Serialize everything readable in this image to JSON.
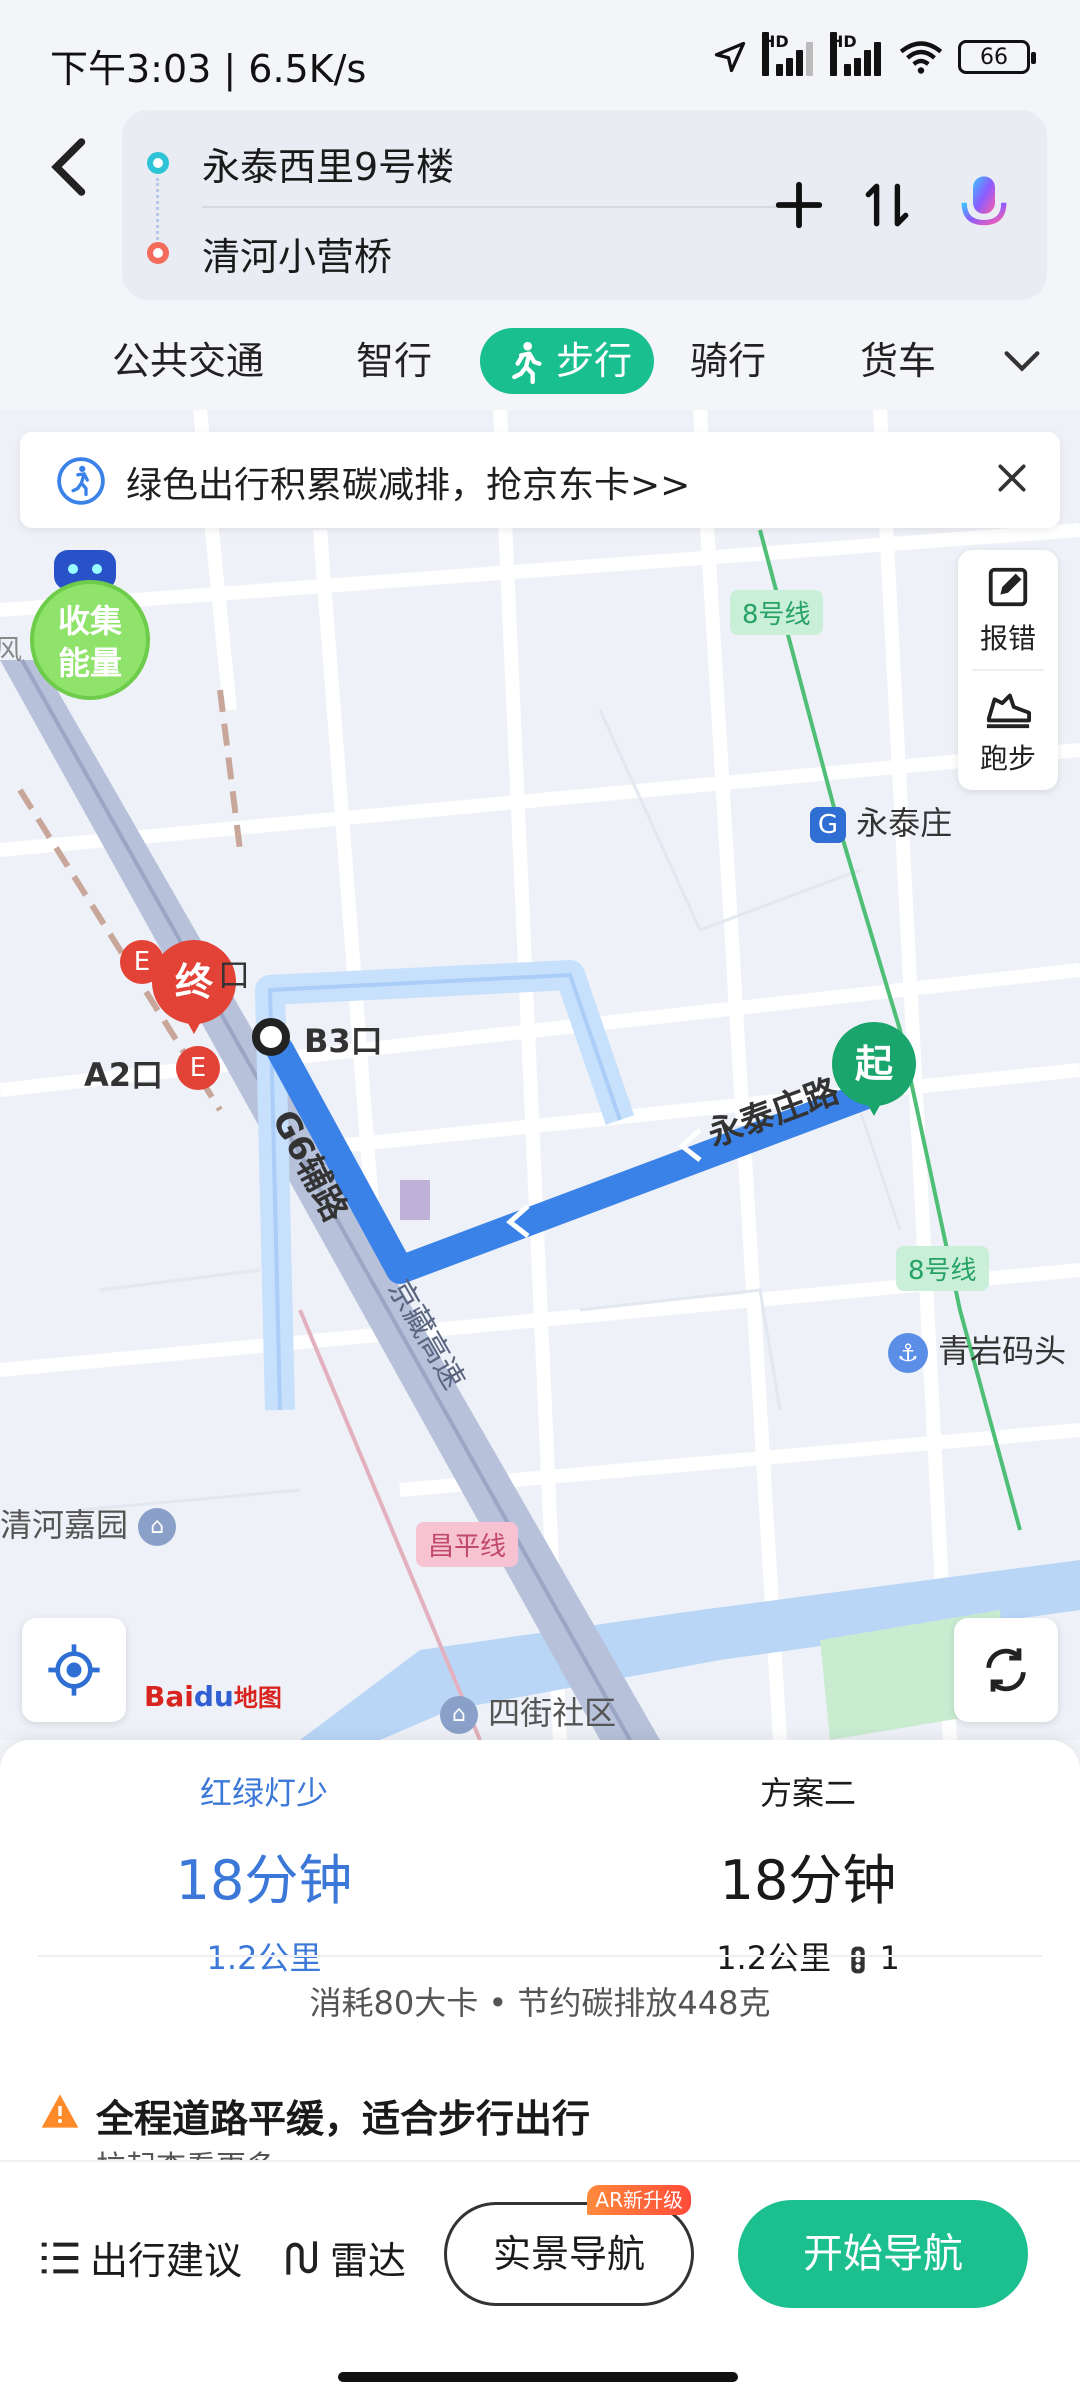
{
  "status_bar": {
    "time": "下午3:03 | 6.5K/s",
    "hd1": "HD",
    "hd2": "HD",
    "battery": "66"
  },
  "route": {
    "start": "永泰西里9号楼",
    "end": "清河小营桥"
  },
  "tabs": [
    {
      "label": "公共交通"
    },
    {
      "label": "智行"
    },
    {
      "label": "步行",
      "active": true
    },
    {
      "label": "骑行"
    },
    {
      "label": "货车"
    }
  ],
  "map": {
    "banner_text": "绿色出行积累碳减排，抢京东卡>>",
    "tools": {
      "report": "报错",
      "run": "跑步"
    },
    "energy": {
      "line1": "收集",
      "line2": "能量"
    },
    "labels": {
      "yongtaizhuang": "永泰庄",
      "qingyan": "青岩码头",
      "qinghe_garden": "清河嘉园",
      "sijie": "四街社区",
      "b3": "B3口",
      "a2": "A2口",
      "mouth": "口",
      "road_g6": "G6辅路",
      "road_yongtai": "永泰庄路",
      "road_jingzang": "京藏高速",
      "wind": "风"
    },
    "line_tags": {
      "line8_top": "8号线",
      "line8_right": "8号线",
      "changping": "昌平线"
    },
    "markers": {
      "start": "起",
      "end": "终"
    },
    "logo": {
      "bai": "Bai",
      "du": "du",
      "ditu": "地图"
    }
  },
  "plans": [
    {
      "tag": "红绿灯少",
      "time": "18分钟",
      "dist": "1.2公里",
      "color": "#3b78d8"
    },
    {
      "tag": "方案二",
      "time": "18分钟",
      "dist": "1.2公里",
      "lights": "1",
      "color": "#1a1a1a"
    }
  ],
  "summary": "消耗80大卡 • 节约碳排放448克",
  "tip": {
    "title": "全程道路平缓，适合步行出行",
    "sub": "拉起查看更多"
  },
  "actions": {
    "advice": "出行建议",
    "radar": "雷达",
    "ar_nav": "实景导航",
    "ar_badge": "AR新升级",
    "start_nav": "开始导航"
  }
}
